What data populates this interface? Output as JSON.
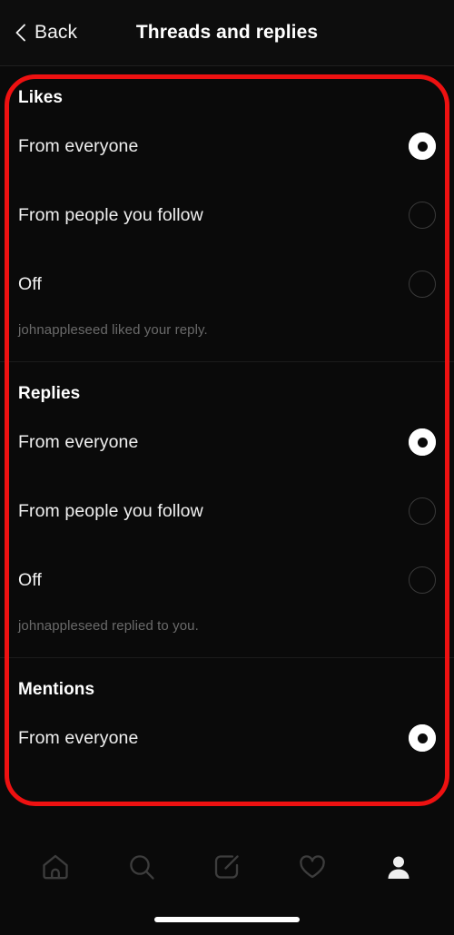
{
  "header": {
    "back_label": "Back",
    "back_icon": "chevron-left-icon",
    "title": "Threads and replies"
  },
  "colors": {
    "background": "#0a0a0a",
    "header_background": "#0d0d0d",
    "text_primary": "#f0f0f0",
    "text_muted": "#6a6a6a",
    "divider": "#1c1c1c",
    "annotation_red": "#ee1111",
    "radio_selected": "#ffffff",
    "radio_unselected_border": "#3a3a3a",
    "nav_icon_inactive": "#3d3d3d",
    "nav_icon_active": "#f0f0f0"
  },
  "sections": [
    {
      "title": "Likes",
      "options": [
        {
          "label": "From everyone",
          "selected": true
        },
        {
          "label": "From people you follow",
          "selected": false
        },
        {
          "label": "Off",
          "selected": false
        }
      ],
      "hint": "johnappleseed liked your reply."
    },
    {
      "title": "Replies",
      "options": [
        {
          "label": "From everyone",
          "selected": true
        },
        {
          "label": "From people you follow",
          "selected": false
        },
        {
          "label": "Off",
          "selected": false
        }
      ],
      "hint": "johnappleseed replied to you."
    },
    {
      "title": "Mentions",
      "options": [
        {
          "label": "From everyone",
          "selected": true
        }
      ],
      "hint": ""
    }
  ],
  "navbar": {
    "items": [
      {
        "icon": "home-icon",
        "active": false
      },
      {
        "icon": "search-icon",
        "active": false
      },
      {
        "icon": "compose-icon",
        "active": false
      },
      {
        "icon": "heart-icon",
        "active": false
      },
      {
        "icon": "profile-icon",
        "active": true
      }
    ]
  }
}
